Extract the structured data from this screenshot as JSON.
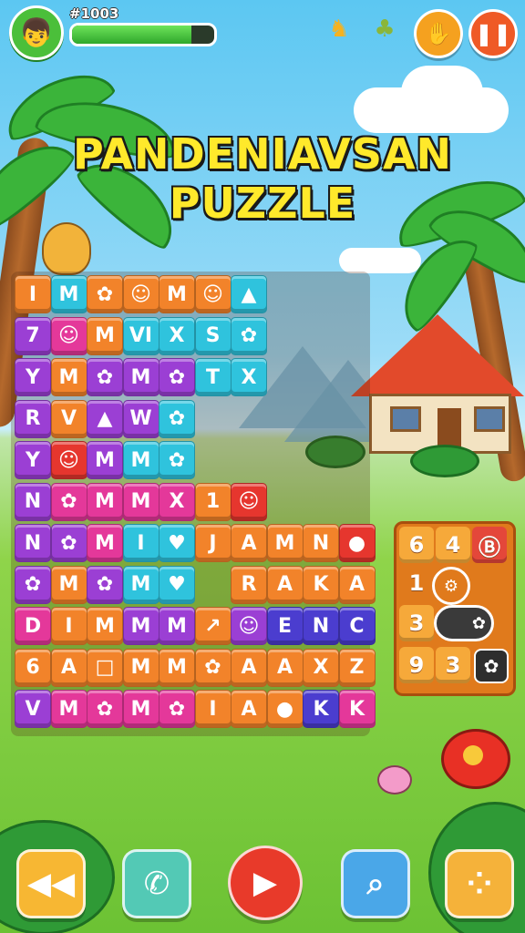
{
  "header": {
    "score": "#1003",
    "progress": 0.84,
    "avatar_icon": "explorer-character-icon",
    "badge1_icon": "gold-creature-icon",
    "badge2_icon": "green-creature-icon",
    "hint_button_icon": "hand-icon",
    "pause_button_icon": "pause-icon"
  },
  "title": {
    "line1": "PANDENIAVSAN",
    "line2": "PUZZLE"
  },
  "board": {
    "rows": [
      [
        "I",
        "M",
        "✿",
        "☺",
        "M",
        "☺",
        "▲"
      ],
      [
        "7",
        "☺",
        "M",
        "VI",
        "X",
        "S",
        "✿"
      ],
      [
        "Y",
        "M",
        "✿",
        "M",
        "✿",
        "T",
        "X"
      ],
      [
        "R",
        "V",
        "▲",
        "W",
        "✿",
        "",
        ""
      ],
      [
        "Y",
        "☺",
        "M",
        "M",
        "✿",
        "",
        ""
      ],
      [
        "N",
        "✿",
        "M",
        "M",
        "X",
        "1",
        "☺"
      ],
      [
        "N",
        "✿",
        "M",
        "I",
        "♥",
        "J",
        "A",
        "M",
        "N",
        "●"
      ],
      [
        "✿",
        "M",
        "✿",
        "M",
        "♥",
        "",
        "R",
        "A",
        "K",
        "A"
      ],
      [
        "D",
        "I",
        "M",
        "M",
        "M",
        "↗",
        "☺",
        "E",
        "N",
        "C"
      ],
      [
        "6",
        "A",
        "□",
        "M",
        "M",
        "✿",
        "A",
        "A",
        "X",
        "Z"
      ],
      [
        "V",
        "M",
        "✿",
        "M",
        "✿",
        "I",
        "A",
        "●",
        "K",
        "K"
      ]
    ]
  },
  "side_panel": {
    "row1": [
      "6",
      "4",
      "Ⓑ"
    ],
    "row2_digit": "1",
    "row3_digit": "3",
    "row4": [
      "9",
      "3"
    ],
    "toggle_icon": "paw-icon",
    "settings_icon": "settings-circle-icon",
    "mini_icon": "paw-icon"
  },
  "bottom_bar": {
    "rewind_icon": "rewind-icon",
    "phone_icon": "phone-icon",
    "play_icon": "play-icon",
    "magnifier_icon": "magnifier-icon",
    "menu_icon": "dots-menu-icon"
  },
  "colors": {
    "orange": "#f2832a",
    "purple": "#9b3fd4",
    "magenta": "#e4389a",
    "cyan": "#2fc3dd",
    "red": "#e6362e",
    "indigo": "#4b3dcf",
    "title_yellow": "#ffe92b"
  }
}
